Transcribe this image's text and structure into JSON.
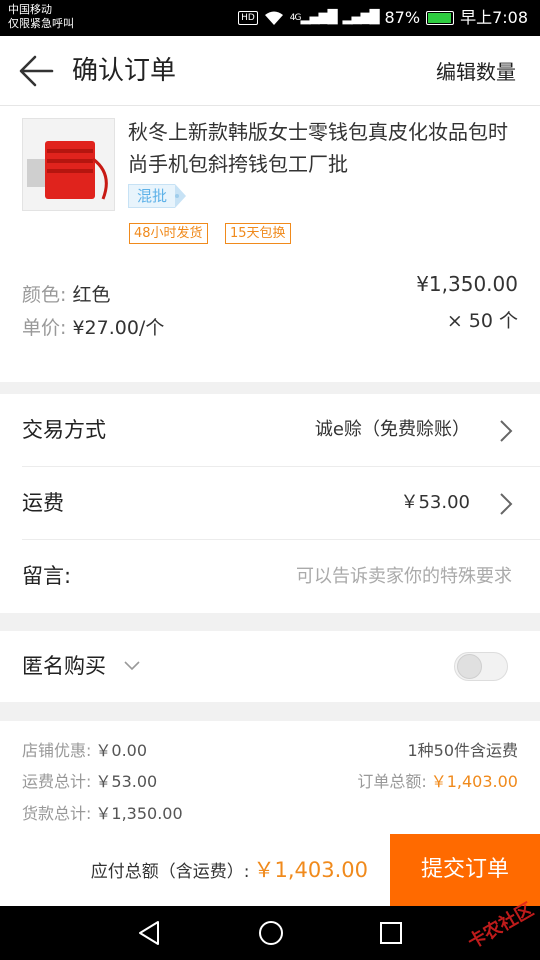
{
  "status_bar": {
    "carrier": "中国移动",
    "carrier_note": "仅限紧急呼叫",
    "hd": "HD",
    "signal": "4G",
    "battery": "87%",
    "time": "早上7:08"
  },
  "header": {
    "title": "确认订单",
    "edit_label": "编辑数量"
  },
  "product": {
    "name": "秋冬上新款韩版女士零钱包真皮化妆品包时尚手机包斜挎钱包工厂批",
    "tag": "混批",
    "badges": [
      "48小时发货",
      "15天包换"
    ],
    "color_label": "颜色:",
    "color_value": "红色",
    "unit_price_label": "单价:",
    "unit_price_value": "¥27.00/个",
    "subtotal": "¥1,350.00",
    "quantity": "× 50 个"
  },
  "options": {
    "trade_label": "交易方式",
    "trade_value": "诚e赊（免费赊账）",
    "shipping_label": "运费",
    "shipping_value": "￥53.00",
    "message_label": "留言:",
    "message_placeholder": "可以告诉卖家你的特殊要求"
  },
  "anonymous": {
    "label": "匿名购买",
    "enabled": false
  },
  "summary": {
    "discount_label": "店铺优惠:",
    "discount_value": "￥0.00",
    "shipping_total_label": "运费总计:",
    "shipping_total_value": "￥53.00",
    "goods_total_label": "货款总计:",
    "goods_total_value": "￥1,350.00",
    "item_count": "1种50件含运费",
    "order_total_label": "订单总额:",
    "order_total_value": "￥1,403.00"
  },
  "bottom_bar": {
    "payable_label": "应付总额（含运费）:",
    "payable_value": "￥1,403.00",
    "submit_label": "提交订单"
  },
  "watermark": "卡农社区",
  "colors": {
    "accent": "#ff6a00",
    "price_orange": "#f08a1c",
    "tag_blue": "#5fb2e8",
    "battery_green": "#2ecc40"
  }
}
